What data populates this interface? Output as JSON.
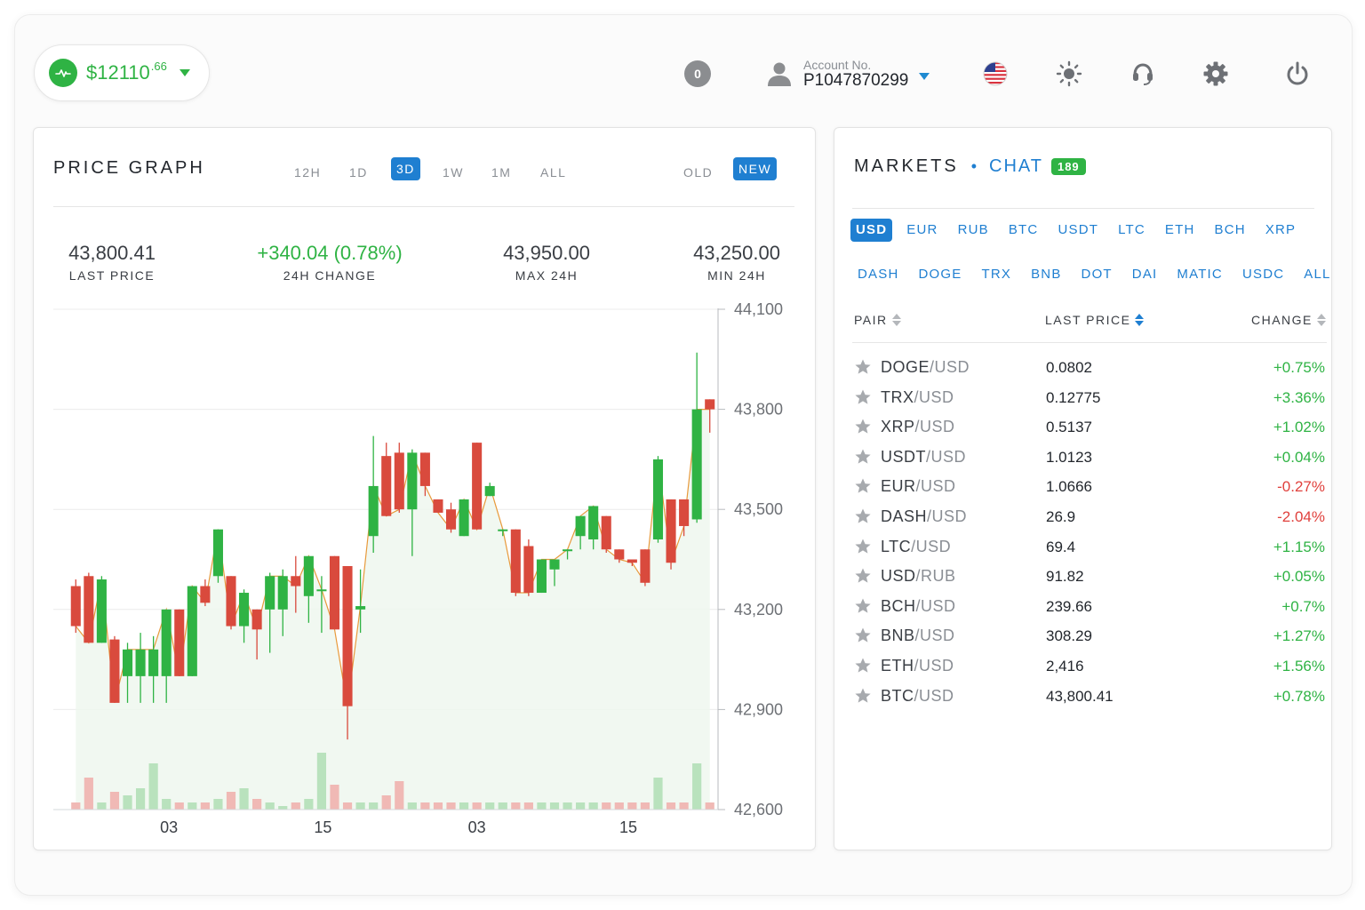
{
  "balance": {
    "amount": "$12110",
    "cents": ".66",
    "color": "#2fb344"
  },
  "header": {
    "notifications": "0",
    "account_label": "Account No.",
    "account_number": "P1047870299",
    "icons": [
      "us-flag-icon",
      "sun-icon",
      "support-icon",
      "gear-icon",
      "power-icon"
    ]
  },
  "price_graph": {
    "title": "PRICE GRAPH",
    "ranges": [
      "12H",
      "1D",
      "3D",
      "1W",
      "1M",
      "ALL"
    ],
    "active_range": "3D",
    "modes": [
      "OLD",
      "NEW"
    ],
    "active_mode": "NEW",
    "stats": [
      {
        "value": "43,800.41",
        "label": "LAST PRICE",
        "tone": "neutral"
      },
      {
        "value": "+340.04 (0.78%)",
        "label": "24H CHANGE",
        "tone": "green"
      },
      {
        "value": "43,950.00",
        "label": "MAX 24H",
        "tone": "neutral"
      },
      {
        "value": "43,250.00",
        "label": "MIN 24H",
        "tone": "neutral"
      }
    ]
  },
  "chart_data": {
    "type": "candlestick",
    "ylim": [
      42600,
      44100
    ],
    "yticks": [
      "44,100",
      "43,800",
      "43,500",
      "43,200",
      "42,900",
      "42,600"
    ],
    "ytick_values": [
      44100,
      43800,
      43500,
      43200,
      42900,
      42600
    ],
    "xticks": [
      {
        "label": "03",
        "index": 7.2
      },
      {
        "label": "15",
        "index": 19.1
      },
      {
        "label": "03",
        "index": 31
      },
      {
        "label": "15",
        "index": 42.7
      }
    ],
    "up_color": "#2fb344",
    "down_color": "#d94a3d",
    "candles": [
      {
        "o": 43270,
        "h": 43290,
        "l": 43130,
        "c": 43150
      },
      {
        "o": 43300,
        "h": 43310,
        "l": 43100,
        "c": 43100
      },
      {
        "o": 43100,
        "h": 43300,
        "l": 43100,
        "c": 43290
      },
      {
        "o": 43110,
        "h": 43120,
        "l": 42920,
        "c": 42920
      },
      {
        "o": 43000,
        "h": 43100,
        "l": 42920,
        "c": 43080
      },
      {
        "o": 43000,
        "h": 43130,
        "l": 42920,
        "c": 43080
      },
      {
        "o": 43000,
        "h": 43120,
        "l": 42920,
        "c": 43080
      },
      {
        "o": 43000,
        "h": 43200,
        "l": 42920,
        "c": 43200
      },
      {
        "o": 43200,
        "h": 43200,
        "l": 43000,
        "c": 43000
      },
      {
        "o": 43000,
        "h": 43270,
        "l": 43000,
        "c": 43270
      },
      {
        "o": 43270,
        "h": 43290,
        "l": 43210,
        "c": 43220
      },
      {
        "o": 43300,
        "h": 43440,
        "l": 43280,
        "c": 43440
      },
      {
        "o": 43300,
        "h": 43300,
        "l": 43140,
        "c": 43150
      },
      {
        "o": 43150,
        "h": 43260,
        "l": 43100,
        "c": 43250
      },
      {
        "o": 43200,
        "h": 43200,
        "l": 43050,
        "c": 43140
      },
      {
        "o": 43200,
        "h": 43310,
        "l": 43070,
        "c": 43300
      },
      {
        "o": 43200,
        "h": 43320,
        "l": 43120,
        "c": 43300
      },
      {
        "o": 43300,
        "h": 43360,
        "l": 43190,
        "c": 43270
      },
      {
        "o": 43240,
        "h": 43360,
        "l": 43160,
        "c": 43360
      },
      {
        "o": 43260,
        "h": 43300,
        "l": 43130,
        "c": 43260
      },
      {
        "o": 43360,
        "h": 43360,
        "l": 43140,
        "c": 43140
      },
      {
        "o": 43330,
        "h": 43330,
        "l": 42810,
        "c": 42910
      },
      {
        "o": 43200,
        "h": 43320,
        "l": 43130,
        "c": 43210
      },
      {
        "o": 43420,
        "h": 43720,
        "l": 43370,
        "c": 43570
      },
      {
        "o": 43660,
        "h": 43700,
        "l": 43480,
        "c": 43480
      },
      {
        "o": 43670,
        "h": 43700,
        "l": 43490,
        "c": 43500
      },
      {
        "o": 43500,
        "h": 43680,
        "l": 43360,
        "c": 43670
      },
      {
        "o": 43670,
        "h": 43670,
        "l": 43540,
        "c": 43570
      },
      {
        "o": 43530,
        "h": 43520,
        "l": 43490,
        "c": 43490
      },
      {
        "o": 43500,
        "h": 43520,
        "l": 43430,
        "c": 43440
      },
      {
        "o": 43420,
        "h": 43530,
        "l": 43420,
        "c": 43530
      },
      {
        "o": 43700,
        "h": 43700,
        "l": 43440,
        "c": 43440
      },
      {
        "o": 43540,
        "h": 43580,
        "l": 43570,
        "c": 43570
      },
      {
        "o": 43440,
        "h": 43440,
        "l": 43420,
        "c": 43440
      },
      {
        "o": 43440,
        "h": 43440,
        "l": 43240,
        "c": 43250
      },
      {
        "o": 43390,
        "h": 43410,
        "l": 43240,
        "c": 43250
      },
      {
        "o": 43250,
        "h": 43350,
        "l": 43250,
        "c": 43350
      },
      {
        "o": 43320,
        "h": 43350,
        "l": 43270,
        "c": 43350
      },
      {
        "o": 43380,
        "h": 43380,
        "l": 43350,
        "c": 43380
      },
      {
        "o": 43420,
        "h": 43480,
        "l": 43380,
        "c": 43480
      },
      {
        "o": 43410,
        "h": 43510,
        "l": 43380,
        "c": 43510
      },
      {
        "o": 43480,
        "h": 43480,
        "l": 43370,
        "c": 43380
      },
      {
        "o": 43380,
        "h": 43350,
        "l": 43340,
        "c": 43350
      },
      {
        "o": 43350,
        "h": 43350,
        "l": 43330,
        "c": 43340
      },
      {
        "o": 43380,
        "h": 43380,
        "l": 43270,
        "c": 43280
      },
      {
        "o": 43410,
        "h": 43660,
        "l": 43400,
        "c": 43650
      },
      {
        "o": 43530,
        "h": 43530,
        "l": 43320,
        "c": 43340
      },
      {
        "o": 43530,
        "h": 43530,
        "l": 43420,
        "c": 43450
      },
      {
        "o": 43470,
        "h": 43970,
        "l": 43460,
        "c": 43800
      },
      {
        "o": 43830,
        "h": 43830,
        "l": 43730,
        "c": 43800
      }
    ],
    "volumes": [
      2,
      9,
      2,
      5,
      4,
      6,
      13,
      3,
      2,
      2,
      2,
      3,
      5,
      6,
      3,
      2,
      1,
      2,
      3,
      16,
      7,
      2,
      2,
      2,
      4,
      8,
      2,
      2,
      2,
      2,
      2,
      2,
      2,
      2,
      2,
      2,
      2,
      2,
      2,
      2,
      2,
      2,
      2,
      2,
      2,
      9,
      2,
      2,
      13,
      2
    ]
  },
  "markets": {
    "title": "MARKETS",
    "chat_label": "CHAT",
    "chat_count": "189",
    "currencies_row1": [
      "USD",
      "EUR",
      "RUB",
      "BTC",
      "USDT",
      "LTC",
      "ETH",
      "BCH",
      "XRP"
    ],
    "currencies_row2": [
      "DASH",
      "DOGE",
      "TRX",
      "BNB",
      "DOT",
      "DAI",
      "MATIC",
      "USDC",
      "ALL"
    ],
    "active_currency": "USD",
    "columns": {
      "pair": "PAIR",
      "last_price": "LAST PRICE",
      "change": "CHANGE"
    },
    "rows": [
      {
        "base": "DOGE",
        "quote": "/USD",
        "price": "0.0802",
        "change": "+0.75%",
        "dir": "pos"
      },
      {
        "base": "TRX",
        "quote": "/USD",
        "price": "0.12775",
        "change": "+3.36%",
        "dir": "pos"
      },
      {
        "base": "XRP",
        "quote": "/USD",
        "price": "0.5137",
        "change": "+1.02%",
        "dir": "pos"
      },
      {
        "base": "USDT",
        "quote": "/USD",
        "price": "1.0123",
        "change": "+0.04%",
        "dir": "pos"
      },
      {
        "base": "EUR",
        "quote": "/USD",
        "price": "1.0666",
        "change": "-0.27%",
        "dir": "neg"
      },
      {
        "base": "DASH",
        "quote": "/USD",
        "price": "26.9",
        "change": "-2.04%",
        "dir": "neg"
      },
      {
        "base": "LTC",
        "quote": "/USD",
        "price": "69.4",
        "change": "+1.15%",
        "dir": "pos"
      },
      {
        "base": "USD",
        "quote": "/RUB",
        "price": "91.82",
        "change": "+0.05%",
        "dir": "pos"
      },
      {
        "base": "BCH",
        "quote": "/USD",
        "price": "239.66",
        "change": "+0.7%",
        "dir": "pos"
      },
      {
        "base": "BNB",
        "quote": "/USD",
        "price": "308.29",
        "change": "+1.27%",
        "dir": "pos"
      },
      {
        "base": "ETH",
        "quote": "/USD",
        "price": "2,416",
        "change": "+1.56%",
        "dir": "pos"
      },
      {
        "base": "BTC",
        "quote": "/USD",
        "price": "43,800.41",
        "change": "+0.78%",
        "dir": "pos"
      }
    ]
  }
}
